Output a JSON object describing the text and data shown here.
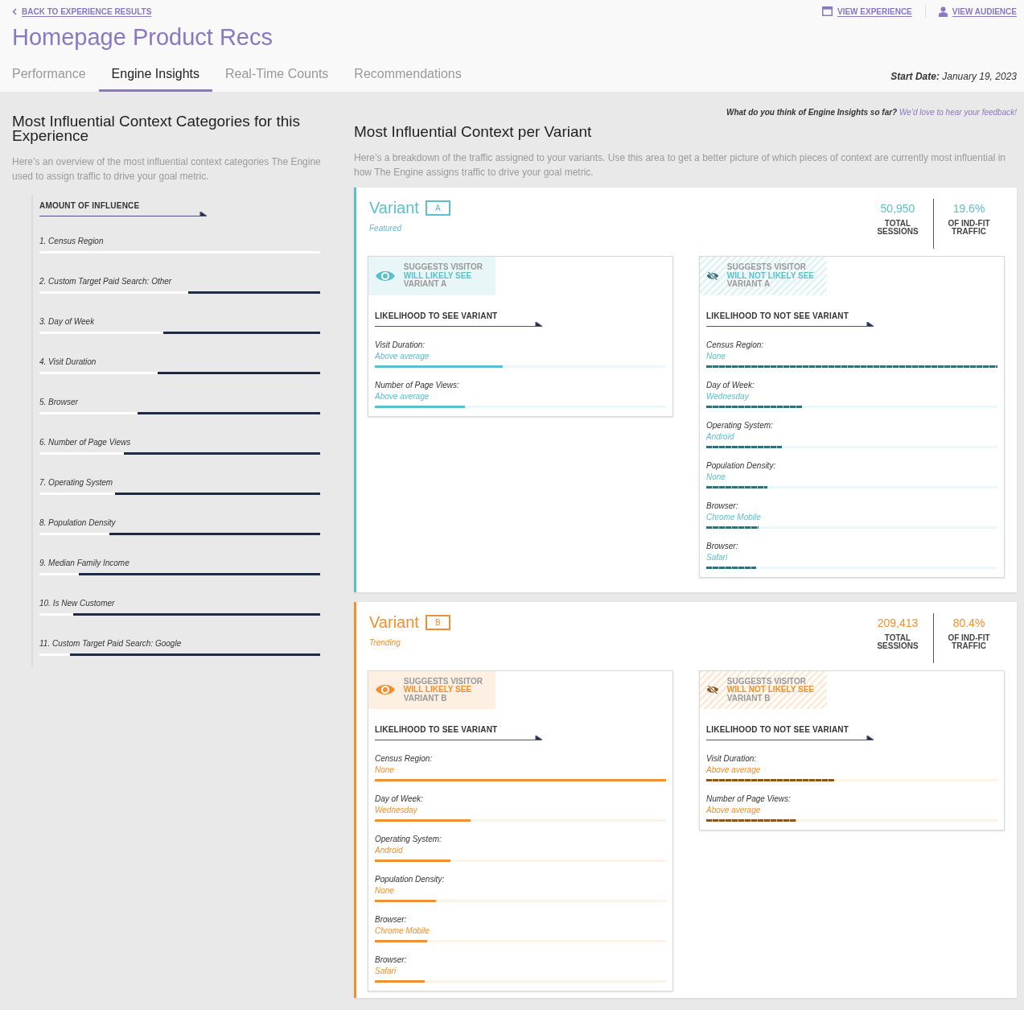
{
  "back_link": "BACK TO EXPERIENCE RESULTS",
  "header_links": [
    {
      "label": "VIEW EXPERIENCE",
      "kind": "experience"
    },
    {
      "label": "VIEW AUDIENCE",
      "kind": "audience"
    }
  ],
  "title": "Homepage Product Recs",
  "tabs": [
    {
      "label": "Performance",
      "selected": false
    },
    {
      "label": "Engine Insights",
      "selected": true
    },
    {
      "label": "Real-Time Counts",
      "selected": false
    },
    {
      "label": "Recommendations",
      "selected": false
    }
  ],
  "start_date": {
    "label": "Start Date:",
    "value": "January 19, 2023"
  },
  "left": {
    "heading": "Most Influential Context Categories for this Experience",
    "description": "Here’s an overview of the most influential context categories The Engine used to assign traffic to drive your goal metric.",
    "axis_label": "AMOUNT OF INFLUENCE",
    "categories": [
      {
        "label": "1. Census Region",
        "level": 0
      },
      {
        "label": "2. Custom Target Paid Search: Other",
        "level": 0.47
      },
      {
        "label": "3. Day of Week",
        "level": 0.56
      },
      {
        "label": "4. Visit Duration",
        "level": 0.58
      },
      {
        "label": "5. Browser",
        "level": 0.65
      },
      {
        "label": "6. Number of Page Views",
        "level": 0.7
      },
      {
        "label": "7. Operating System",
        "level": 0.73
      },
      {
        "label": "8. Population Density",
        "level": 0.75
      },
      {
        "label": "9. Median Family Income",
        "level": 0.86
      },
      {
        "label": "10. Is New Customer",
        "level": 0.88
      },
      {
        "label": "11. Custom Target Paid Search: Google",
        "level": 0.89
      }
    ]
  },
  "feedback": {
    "question": "What do you think of Engine Insights so far?",
    "link": "We’d love to hear your feedback!"
  },
  "right": {
    "heading": "Most Influential Context per Variant",
    "description": "Here’s a breakdown of the traffic assigned to your variants. Use this area to get a better picture of which pieces of context are currently most influential in how The Engine assigns traffic to drive your goal metric."
  },
  "variants": [
    {
      "name": "Variant",
      "letter": "A",
      "tag": "Featured",
      "color": "#5cbfce",
      "sessions": "50,950",
      "sessions_label": "TOTAL SESSIONS",
      "share": "19.6%",
      "share_label": "OF IND-FIT TRAFFIC",
      "panels": [
        {
          "kind": "see",
          "badge": [
            "SUGGESTS VISITOR",
            "WILL LIKELY SEE",
            "VARIANT A"
          ],
          "axis_label": "LIKELIHOOD TO SEE VARIANT",
          "rows": [
            {
              "label": "Visit Duration:",
              "value": "Above average",
              "level": 0.44
            },
            {
              "label": "Number of Page Views:",
              "value": "Above average",
              "level": 0.31
            }
          ]
        },
        {
          "kind": "not",
          "badge": [
            "SUGGESTS VISITOR",
            "WILL NOT LIKELY SEE",
            "VARIANT A"
          ],
          "axis_label": "LIKELIHOOD TO NOT SEE VARIANT",
          "rows": [
            {
              "label": "Census Region:",
              "value": "None",
              "level": 1
            },
            {
              "label": "Day of Week:",
              "value": "Wednesday",
              "level": 0.33
            },
            {
              "label": "Operating System:",
              "value": "Android",
              "level": 0.26
            },
            {
              "label": "Population Density:",
              "value": "None",
              "level": 0.21
            },
            {
              "label": "Browser:",
              "value": "Chrome Mobile",
              "level": 0.18
            },
            {
              "label": "Browser:",
              "value": "Safari",
              "level": 0.17
            }
          ]
        }
      ]
    },
    {
      "name": "Variant",
      "letter": "B",
      "tag": "Trending",
      "color": "#f0902e",
      "sessions": "209,413",
      "sessions_label": "TOTAL SESSIONS",
      "share": "80.4%",
      "share_label": "OF IND-FIT TRAFFIC",
      "panels": [
        {
          "kind": "see",
          "badge": [
            "SUGGESTS VISITOR",
            "WILL LIKELY SEE",
            "VARIANT B"
          ],
          "axis_label": "LIKELIHOOD TO SEE VARIANT",
          "rows": [
            {
              "label": "Census Region:",
              "value": "None",
              "level": 1
            },
            {
              "label": "Day of Week:",
              "value": "Wednesday",
              "level": 0.33
            },
            {
              "label": "Operating System:",
              "value": "Android",
              "level": 0.26
            },
            {
              "label": "Population Density:",
              "value": "None",
              "level": 0.21
            },
            {
              "label": "Browser:",
              "value": "Chrome Mobile",
              "level": 0.18
            },
            {
              "label": "Browser:",
              "value": "Safari",
              "level": 0.17
            }
          ]
        },
        {
          "kind": "not",
          "badge": [
            "SUGGESTS VISITOR",
            "WILL NOT LIKELY SEE",
            "VARIANT B"
          ],
          "axis_label": "LIKELIHOOD TO NOT SEE VARIANT",
          "rows": [
            {
              "label": "Visit Duration:",
              "value": "Above average",
              "level": 0.44
            },
            {
              "label": "Number of Page Views:",
              "value": "Above average",
              "level": 0.31
            }
          ]
        }
      ]
    }
  ]
}
